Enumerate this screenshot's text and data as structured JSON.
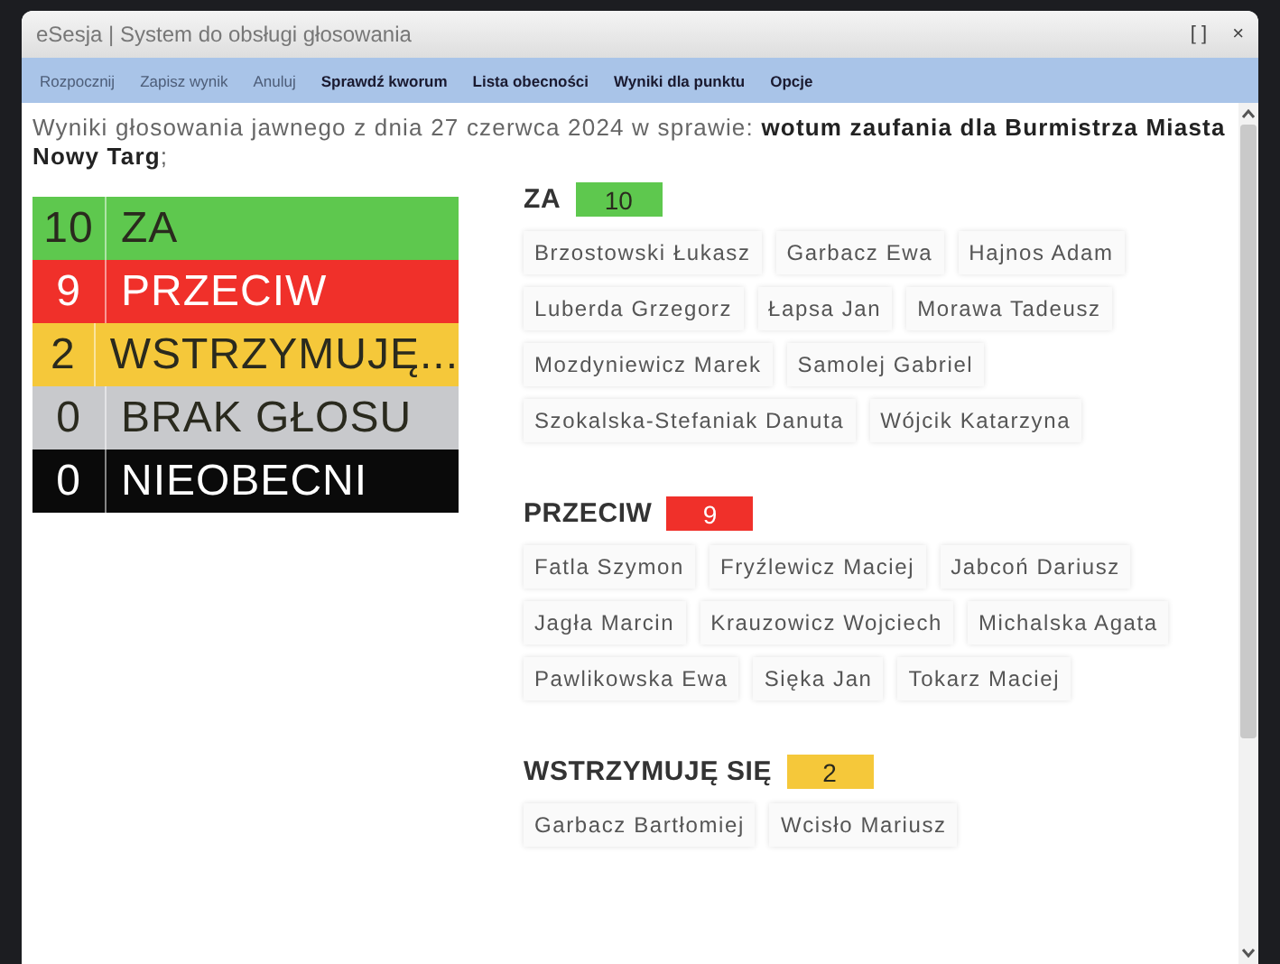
{
  "window": {
    "title": "eSesja | System do obsługi głosowania",
    "controls": [
      "[ ]",
      "×"
    ]
  },
  "toolbar": [
    {
      "label": "Rozpocznij",
      "disabled": true
    },
    {
      "label": "Zapisz wynik",
      "disabled": true
    },
    {
      "label": "Anuluj",
      "disabled": true
    },
    {
      "label": "Sprawdź kworum",
      "disabled": false
    },
    {
      "label": "Lista obecności",
      "disabled": false
    },
    {
      "label": "Wyniki dla punktu",
      "disabled": false
    },
    {
      "label": "Opcje",
      "disabled": false
    }
  ],
  "heading": "Wyniki głosowania jawnego z dnia 27 czerwca 2024 w sprawie: **wotum zaufania dla Burmistrza Miasta Nowy Targ**;",
  "summary": [
    {
      "count": "10",
      "label": "ZA",
      "color": "#5ec84e"
    },
    {
      "count": "9",
      "label": "PRZECIW",
      "color": "#f0302a"
    },
    {
      "count": "2",
      "label": "WSTRZYMUJĘ...",
      "color": "#f5c83a"
    },
    {
      "count": "0",
      "label": "BRAK GŁOSU",
      "color": "#c8c9cc"
    },
    {
      "count": "0",
      "label": "NIEOBECNI",
      "color": "#0a0a0a"
    }
  ],
  "groups": [
    {
      "label": "ZA",
      "count": "10",
      "color": "#5ec84e",
      "names": [
        "Brzostowski Łukasz",
        "Garbacz Ewa",
        "Hajnos Adam",
        "Luberda Grzegorz",
        "Łapsa Jan",
        "Morawa Tadeusz",
        "Mozdyniewicz Marek",
        "Samolej Gabriel",
        "Szokalska-Stefaniak Danuta",
        "Wójcik Katarzyna"
      ]
    },
    {
      "label": "PRZECIW",
      "count": "9",
      "color": "#f0302a",
      "names": [
        "Fatla Szymon",
        "Fryźlewicz Maciej",
        "Jabcoń Dariusz",
        "Jagła Marcin",
        "Krauzowicz Wojciech",
        "Michalska Agata",
        "Pawlikowska Ewa",
        "Sięka Jan",
        "Tokarz Maciej"
      ]
    },
    {
      "label": "WSTRZYMUJĘ SIĘ",
      "count": "2",
      "color": "#f5c83a",
      "names": [
        "Garbacz Bartłomiej",
        "Wcisło Mariusz"
      ]
    }
  ]
}
